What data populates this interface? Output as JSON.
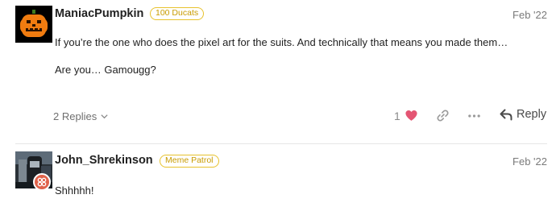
{
  "posts": [
    {
      "username": "ManiacPumpkin",
      "flair": "100 Ducats",
      "date": "Feb '22",
      "paragraphs": [
        "If you’re the one who does the pixel art for the suits. And technically that means you made them…",
        "Are you… Gamougg?"
      ],
      "replies_label": "2 Replies",
      "like_count": "1",
      "reply_label": "Reply",
      "avatar_icon": "pumpkin-pixel-avatar"
    },
    {
      "username": "John_Shrekinson",
      "flair": "Meme Patrol",
      "date": "Feb '22",
      "paragraphs": [
        "Shhhhh!"
      ],
      "avatar_icon": "photo-avatar",
      "badge_icon": "group-badge-icon"
    }
  ],
  "colors": {
    "flair_border": "#e7c22d",
    "flair_text": "#c89b00",
    "heart": "#e45573",
    "badge": "#e0624a"
  }
}
